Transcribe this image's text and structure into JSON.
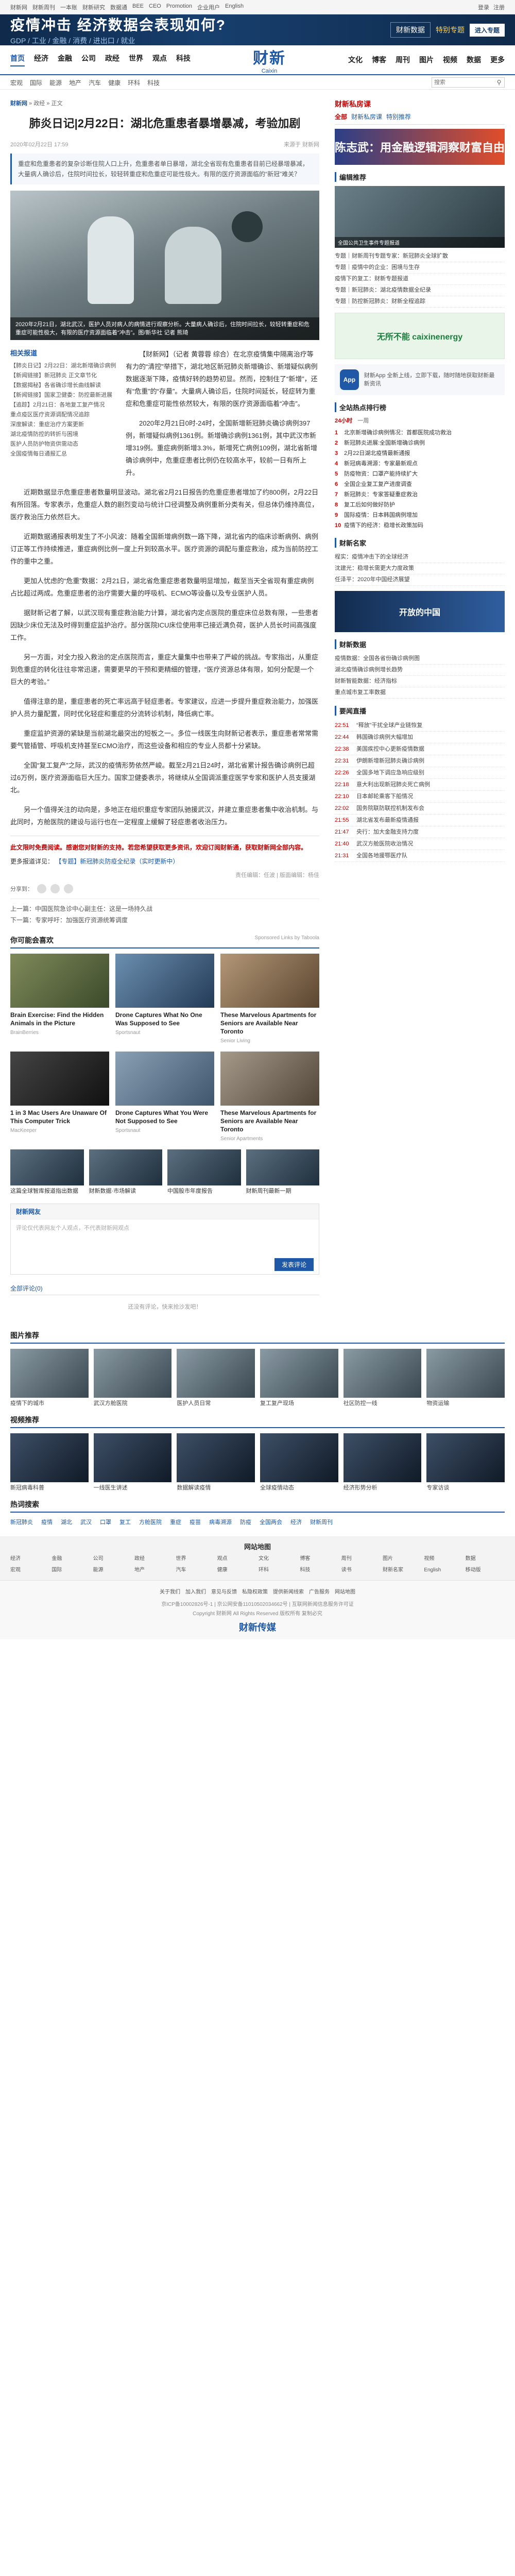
{
  "topbar": {
    "links": [
      "财新网",
      "财新周刊",
      "一本账",
      "财新研究",
      "数据通",
      "BEE",
      "CEO",
      "Promotion",
      "企业用户",
      "English"
    ],
    "right": [
      "登录",
      "注册"
    ]
  },
  "banner": {
    "title": "疫情冲击 经济数据会表现如何?",
    "subtitle": "GDP / 工业 / 金融 / 消费 / 进出口 / 就业",
    "logo": "财新数据",
    "special": "特别专题",
    "button": "进入专题"
  },
  "nav": {
    "left": [
      "首页",
      "经济",
      "金融",
      "公司",
      "政经",
      "世界",
      "观点",
      "科技"
    ],
    "right": [
      "文化",
      "博客",
      "周刊",
      "图片",
      "视频",
      "数据",
      "更多"
    ],
    "logo_cn": "财新",
    "logo_en": "Caixin"
  },
  "subnav": {
    "items": [
      "宏观",
      "国际",
      "能源",
      "地产",
      "汽车",
      "健康",
      "环科",
      "科技"
    ],
    "search_placeholder": "搜索"
  },
  "article": {
    "breadcrumb": [
      "财新网",
      "政经",
      "正文"
    ],
    "title": "肺炎日记|2月22日：湖北危重患者暴增暴减，考验加剧",
    "date": "2020年02月22日 17:59",
    "source": "来源于 财新网",
    "summary": "重症和危重患者的复杂诊断住院人口上升，危重患者单日暴增，湖北全省现有危重患者目前已经暴增暴减，大量病人确诊后，住院时间拉长，较轻转重症和危重症可能性极大。有限的医疗资源面临的“新冠”难关？",
    "photo_caption": "2020年2月21日，湖北武汉，医护人员对病人的病情进行观察分析。大量病人确诊后，住院时间拉长，较轻转重症和危重症可能性极大，有限的医疗资源面临着“冲击”。图/新华社 记者 熊琦",
    "related_title": "相关报道",
    "related": [
      "【肺炎日记】2月22日：湖北新增确诊病例",
      "【新闻链接】新冠肺炎 正文章节化",
      "【数据揭秘】各省确诊增长曲线解读",
      "【新闻链接】国家卫健委：防控最新进展",
      "【追踪】2月21日：各地复工复产情况",
      "重点疫区医疗资源调配情况追踪",
      "深度解读：重症治疗方案更新",
      "湖北疫情防控的转折与困境",
      "医护人员防护物资供需动态",
      "全国疫情每日通报汇总"
    ],
    "paragraphs": [
      "【财新网】（记者 黄蓉蓉 综合）在北京疫情集中隔离治疗等有力的“清控”举措下，湖北地区新冠肺炎新增确诊、新增疑似病例数据逐渐下降，疫情好转的趋势初显。然而，控制住了“新增”，还有“危重”的“存量”。大量病人确诊后，住院时间延长，轻症转为重症和危重症可能性依然较大，有限的医疗资源面临着“冲击”。",
      "2020年2月21日0时-24时，全国新增新冠肺炎确诊病例397例，新增疑似病例1361例。新增确诊病例1361例，其中武汉市新增319例。重症病例新增3.3%，新增死亡病例109例，湖北省新增确诊病例中，危重症患者比例仍在较高水平，较前一日有所上升。",
      "近期数据显示危重症患者数量明显波动。湖北省2月21日报告的危重症患者增加了约800例，2月22日有所回落。专家表示，危重症人数的剧烈变动与统计口径调整及病例重新分类有关，但总体仍维持高位，医疗救治压力依然巨大。",
      "近期数据通报表明发生了不小风波：随着全国新增病例数一路下降，湖北省内的临床诊断病例、病例订正等工作持续推进，重症病例比例一度上升到较高水平。医疗资源的调配与重症救治，成为当前防控工作的重中之重。",
      "更加人忧虑的“危重”数据：2月21日，湖北省危重症患者数量明显增加，截至当天全省现有重症病例占比超过两成。危重症患者的治疗需要大量的呼吸机、ECMO等设备以及专业医护人员。",
      "据财新记者了解，以武汉现有重症救治能力计算，湖北省内定点医院的重症床位总数有限，一些患者因缺少床位无法及时得到重症监护治疗。部分医院ICU床位使用率已接近满负荷，医护人员长时间高强度工作。",
      "另一方面，对全力投入救治的定点医院而言，重症大量集中也带来了严峻的挑战。专家指出，从重症到危重症的转化往往非常迅速，需要更早的干预和更精细的管理，“医疗资源总体有限，如何分配是一个巨大的考验。”",
      "值得注意的是，重症患者的死亡率远高于轻症患者。专家建议，应进一步提升重症救治能力，加强医护人员力量配置，同时优化轻症和重症的分流转诊机制，降低病亡率。",
      "重症监护资源的紧缺是当前湖北最突出的短板之一。多位一线医生向财新记者表示，重症患者常常需要气管插管、呼吸机支持甚至ECMO治疗，而这些设备和相应的专业人员都十分紧缺。",
      "全国“复工复产”之际，武汉的疫情形势依然严峻。截至2月21日24时，湖北省累计报告确诊病例已超过6万例，医疗资源面临巨大压力。国家卫健委表示，将继续从全国调派重症医学专家和医护人员支援湖北。",
      "另一个值得关注的动向是，多地正在组织重症专家团队驰援武汉，并建立重症患者集中收治机制。与此同时，方舱医院的建设与运行也在一定程度上缓解了轻症患者收治压力。"
    ],
    "notice": "此文限时免费阅读。感谢您对财新的支持。若您希望获取更多资讯，欢迎订阅财新通，获取财新网全部内容。",
    "more_label": "更多报道详见：",
    "more_link": "【专题】新冠肺炎防疫全纪录（实时更新中）",
    "editor": "责任编辑：任波 | 版面编辑：杨佳",
    "share_label": "分享到：",
    "prev": "上一篇：中国医院急诊中心副主任：这是一场持久战",
    "next": "下一篇：专家呼吁：加强医疗资源统筹调度"
  },
  "ads": {
    "title": "你可能会喜欢",
    "sponsor": "Sponsored Links by Taboola",
    "items": [
      {
        "headline": "Brain Exercise: Find the Hidden Animals in the Picture",
        "src": "BrainBerries"
      },
      {
        "headline": "Drone Captures What No One Was Supposed to See",
        "src": "Sportsnaut"
      },
      {
        "headline": "These Marvelous Apartments for Seniors are Available Near Toronto",
        "src": "Senior Living"
      },
      {
        "headline": "1 in 3 Mac Users Are Unaware Of This Computer Trick",
        "src": "MacKeeper"
      },
      {
        "headline": "Drone Captures What You Were Not Supposed to See",
        "src": "Sportsnaut"
      },
      {
        "headline": "These Marvelous Apartments for Seniors are Available Near Toronto",
        "src": "Senior Apartments"
      }
    ],
    "small": [
      "这篇全球智库报道指出数据",
      "财新数据·市场解读",
      "中国股市年度报告",
      "财新周刊最新一期"
    ]
  },
  "comment": {
    "title": "财新网友",
    "placeholder": "评论仅代表网友个人观点，不代表财新网观点",
    "submit": "发表评论",
    "list_title": "全部评论(0)",
    "empty": "还没有评论，快来抢沙发吧！"
  },
  "sidebar": {
    "channel": "财新私房课",
    "tabs": [
      "全部",
      "财新私房课",
      "特别推荐"
    ],
    "banner_text": "陈志武：用金融逻辑洞察财富自由",
    "editor_pick_title": "编辑推荐",
    "editor_picks": [
      "专题｜财新周刊专题专家：新冠肺炎全球扩散",
      "专题｜疫情中的企业：困境与生存",
      "疫情下的复工：财新专题报道",
      "专题｜新冠肺炎：湖北疫情数据全纪录",
      "专题｜防控新冠肺炎：财新全程追踪"
    ],
    "pic_caption": "全国公共卫生事件专题报道",
    "ad_text": "无所不能 caixinenergy",
    "app_text": "财新App 全新上线，立即下载，随时随地获取财新最新资讯",
    "rank_title": "全站热点排行榜",
    "rank_tabs": [
      "24小时",
      "一周"
    ],
    "rank": [
      "北京新增确诊病例情况：首都医院成功救治",
      "新冠肺炎进展:全国新增确诊病例",
      "2月22日湖北疫情最新通报",
      "新冠病毒溯源：专家最新观点",
      "防疫物资：口罩产能持续扩大",
      "全国企业复工复产进度调查",
      "新冠肺炎：专家答疑重症救治",
      "复工后如何做好防护",
      "国际疫情：日本韩国病例增加",
      "疫情下的经济：稳增长政策加码"
    ],
    "column_title": "财新名家",
    "columns": [
      "程实：疫情冲击下的全球经济",
      "沈建光：稳增长需更大力度政策",
      "任泽平：2020年中国经济展望"
    ],
    "img2_text": "开放的中国",
    "data_title": "财新数据",
    "data_items": [
      "疫情数据：全国各省份确诊病例图",
      "湖北疫情确诊病例增长趋势",
      "财新智能数据：经济指标",
      "重点城市复工率数据"
    ],
    "live_title": "要闻直播",
    "live": [
      {
        "t": "22:51",
        "text": "“释放”干扰全球产业链恢复"
      },
      {
        "t": "22:44",
        "text": "韩国确诊病例大幅增加"
      },
      {
        "t": "22:38",
        "text": "美国疾控中心更新疫情数据"
      },
      {
        "t": "22:31",
        "text": "伊朗新增新冠肺炎确诊病例"
      },
      {
        "t": "22:26",
        "text": "全国多地下调应急响应级别"
      },
      {
        "t": "22:18",
        "text": "意大利出现新冠肺炎死亡病例"
      },
      {
        "t": "22:10",
        "text": "日本邮轮乘客下船情况"
      },
      {
        "t": "22:02",
        "text": "国务院联防联控机制发布会"
      },
      {
        "t": "21:55",
        "text": "湖北省发布最新疫情通报"
      },
      {
        "t": "21:47",
        "text": "央行：加大金融支持力度"
      },
      {
        "t": "21:40",
        "text": "武汉方舱医院收治情况"
      },
      {
        "t": "21:31",
        "text": "全国各地援鄂医疗队"
      }
    ]
  },
  "bottom": {
    "pics_title": "图片推荐",
    "pics": [
      "疫情下的城市",
      "武汉方舱医院",
      "医护人员日常",
      "复工复产现场",
      "社区防控一线",
      "物资运输"
    ],
    "video_title": "视频推荐",
    "videos": [
      "新冠病毒科普",
      "一线医生讲述",
      "数据解读疫情",
      "全球疫情动态",
      "经济形势分析",
      "专家访谈"
    ],
    "hot_title": "热词搜索",
    "hot": [
      "新冠肺炎",
      "疫情",
      "湖北",
      "武汉",
      "口罩",
      "复工",
      "方舱医院",
      "重症",
      "疫苗",
      "病毒溯源",
      "防疫",
      "全国两会",
      "经济",
      "财新周刊"
    ],
    "sitemap_title": "网站地图",
    "sitemap": [
      "经济",
      "金融",
      "公司",
      "政经",
      "世界",
      "观点",
      "文化",
      "博客",
      "周刊",
      "图片",
      "视频",
      "数据",
      "宏观",
      "国际",
      "能源",
      "地产",
      "汽车",
      "健康",
      "环科",
      "科技",
      "读书",
      "财新名家",
      "English",
      "移动版"
    ],
    "footer_links": [
      "关于我们",
      "加入我们",
      "意见与反馈",
      "私隐权政策",
      "提供新闻线索",
      "广告服务",
      "网站地图"
    ],
    "footer_copy": "京ICP备10002826号-1 | 京公网安备11010502034662号 | 互联网新闻信息服务许可证",
    "footer_copy2": "Copyright 财新网 All Rights Reserved 版权所有 复制必究",
    "foot_logo": "财新传媒"
  }
}
